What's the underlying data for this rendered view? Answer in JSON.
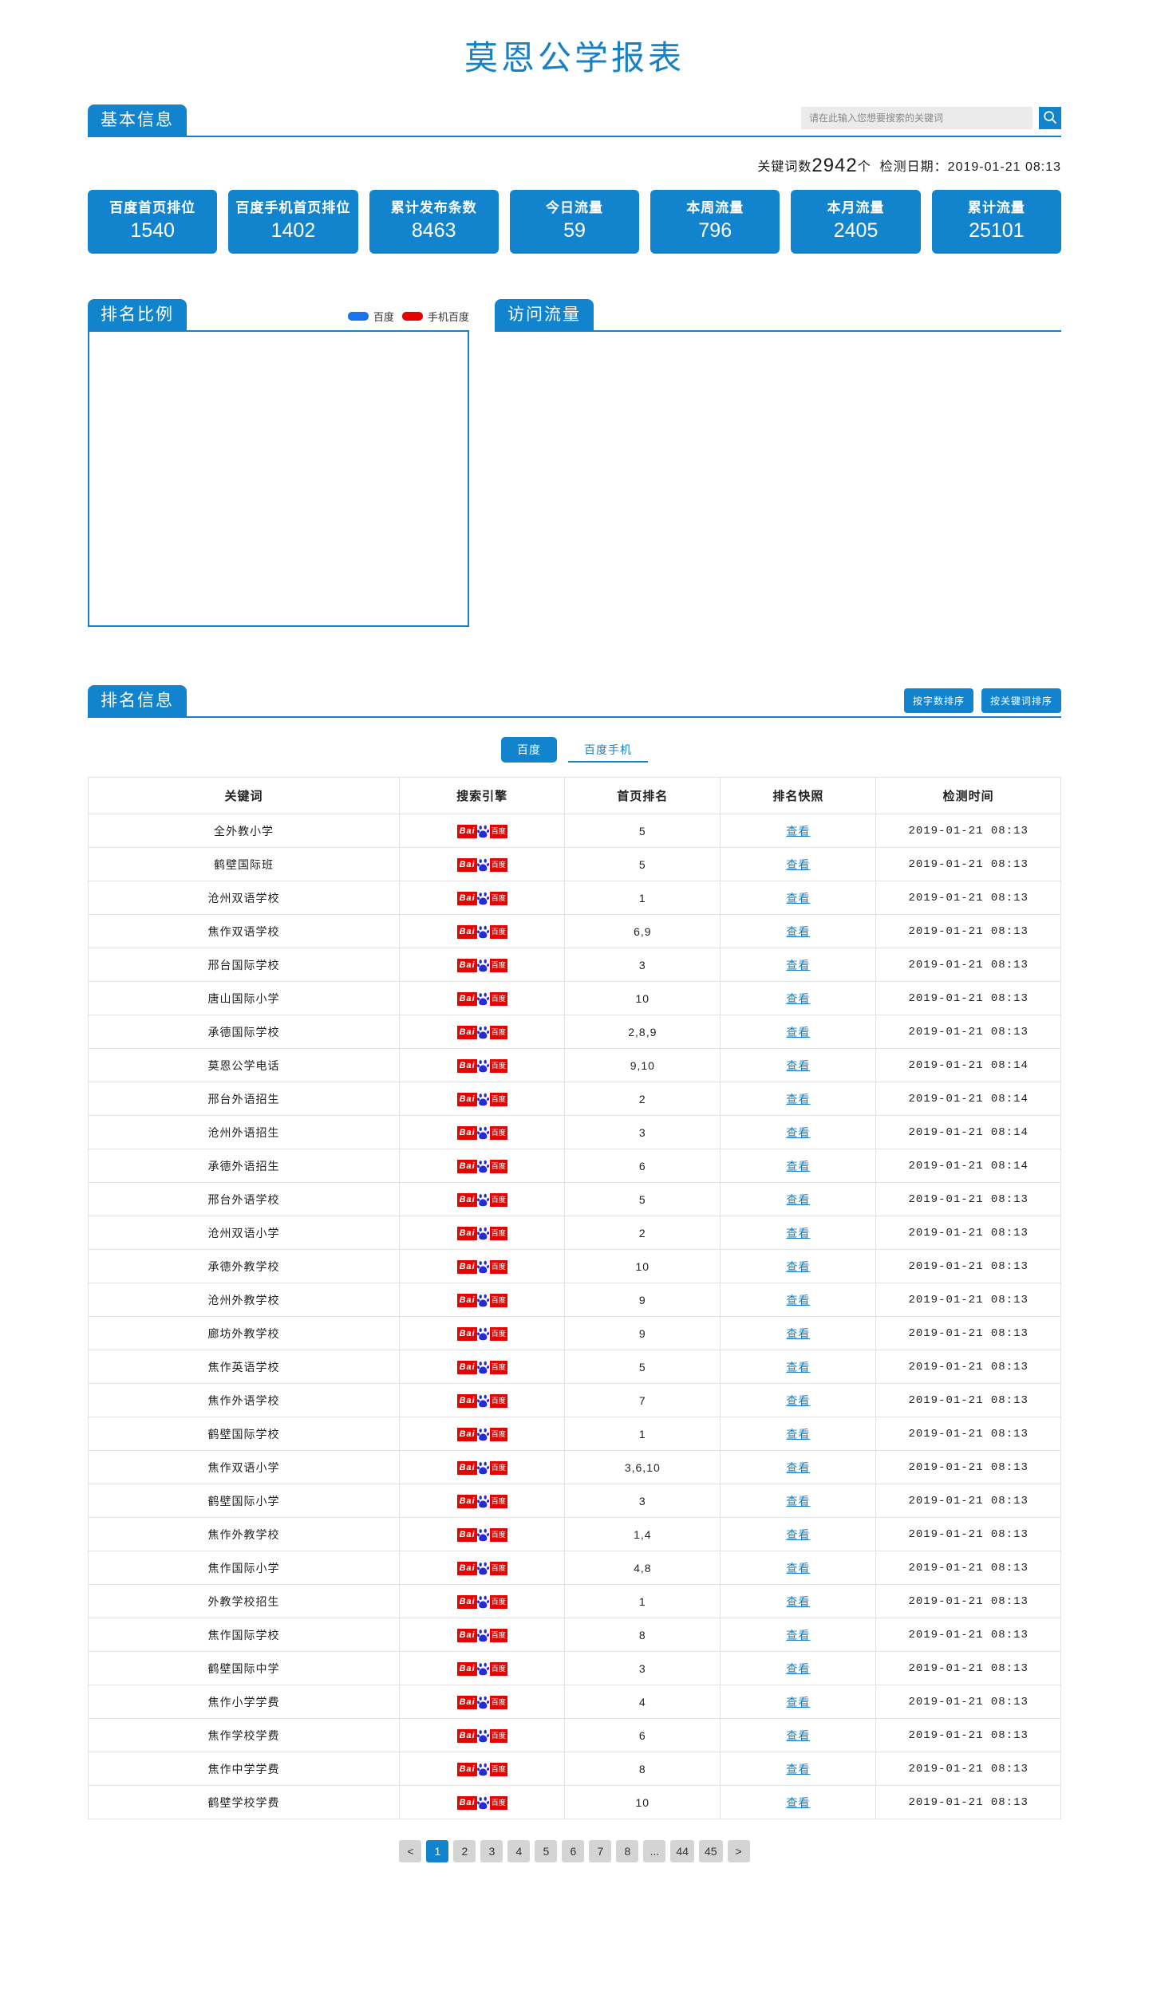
{
  "page_title": "莫恩公学报表",
  "colors": {
    "brand_blue": "#1284cd",
    "border_blue": "#1880c4",
    "baidu_red": "#e10602",
    "legend_baidu": "#1a73e8",
    "legend_mobile": "#e10602"
  },
  "basic_info": {
    "tab_label": "基本信息",
    "search_placeholder": "请在此输入您想要搜索的关键词",
    "search_value": "",
    "search_icon": "search-icon",
    "meta_prefix": "关键词数",
    "meta_count": "2942",
    "meta_unit": "个",
    "meta_date_label": "检测日期：",
    "meta_date_value": "2019-01-21 08:13"
  },
  "stats": [
    {
      "label": "百度首页排位",
      "value": "1540"
    },
    {
      "label": "百度手机首页排位",
      "value": "1402"
    },
    {
      "label": "累计发布条数",
      "value": "8463"
    },
    {
      "label": "今日流量",
      "value": "59"
    },
    {
      "label": "本周流量",
      "value": "796"
    },
    {
      "label": "本月流量",
      "value": "2405"
    },
    {
      "label": "累计流量",
      "value": "25101"
    }
  ],
  "rank_ratio": {
    "tab_label": "排名比例",
    "legend": [
      {
        "name": "百度",
        "color": "#1a73e8"
      },
      {
        "name": "手机百度",
        "color": "#e10602"
      }
    ]
  },
  "visit_traffic": {
    "tab_label": "访问流量"
  },
  "chart_data": [
    {
      "type": "pie",
      "title": "排名比例",
      "legend": [
        "百度",
        "手机百度"
      ],
      "legend_position": "top-right",
      "categories": [],
      "values": [],
      "note": "chart area rendered empty in screenshot"
    },
    {
      "type": "line",
      "title": "访问流量",
      "x": [],
      "series": [],
      "note": "chart area rendered empty in screenshot"
    }
  ],
  "rank_info": {
    "tab_label": "排名信息",
    "sort_buttons": [
      {
        "label": "按字数排序"
      },
      {
        "label": "按关键词排序"
      }
    ],
    "engine_tabs": [
      {
        "label": "百度",
        "active": true
      },
      {
        "label": "百度手机",
        "active": false
      }
    ],
    "columns": [
      "关键词",
      "搜索引擎",
      "首页排名",
      "排名快照",
      "检测时间"
    ],
    "snapshot_label": "查看",
    "engine_logo": "baidu-logo",
    "rows": [
      {
        "keyword": "全外教小学",
        "rank": "5",
        "time": "2019-01-21 08:13"
      },
      {
        "keyword": "鹤壁国际班",
        "rank": "5",
        "time": "2019-01-21 08:13"
      },
      {
        "keyword": "沧州双语学校",
        "rank": "1",
        "time": "2019-01-21 08:13"
      },
      {
        "keyword": "焦作双语学校",
        "rank": "6,9",
        "time": "2019-01-21 08:13"
      },
      {
        "keyword": "邢台国际学校",
        "rank": "3",
        "time": "2019-01-21 08:13"
      },
      {
        "keyword": "唐山国际小学",
        "rank": "10",
        "time": "2019-01-21 08:13"
      },
      {
        "keyword": "承德国际学校",
        "rank": "2,8,9",
        "time": "2019-01-21 08:13"
      },
      {
        "keyword": "莫恩公学电话",
        "rank": "9,10",
        "time": "2019-01-21 08:14"
      },
      {
        "keyword": "邢台外语招生",
        "rank": "2",
        "time": "2019-01-21 08:14"
      },
      {
        "keyword": "沧州外语招生",
        "rank": "3",
        "time": "2019-01-21 08:14"
      },
      {
        "keyword": "承德外语招生",
        "rank": "6",
        "time": "2019-01-21 08:14"
      },
      {
        "keyword": "邢台外语学校",
        "rank": "5",
        "time": "2019-01-21 08:13"
      },
      {
        "keyword": "沧州双语小学",
        "rank": "2",
        "time": "2019-01-21 08:13"
      },
      {
        "keyword": "承德外教学校",
        "rank": "10",
        "time": "2019-01-21 08:13"
      },
      {
        "keyword": "沧州外教学校",
        "rank": "9",
        "time": "2019-01-21 08:13"
      },
      {
        "keyword": "廊坊外教学校",
        "rank": "9",
        "time": "2019-01-21 08:13"
      },
      {
        "keyword": "焦作英语学校",
        "rank": "5",
        "time": "2019-01-21 08:13"
      },
      {
        "keyword": "焦作外语学校",
        "rank": "7",
        "time": "2019-01-21 08:13"
      },
      {
        "keyword": "鹤壁国际学校",
        "rank": "1",
        "time": "2019-01-21 08:13"
      },
      {
        "keyword": "焦作双语小学",
        "rank": "3,6,10",
        "time": "2019-01-21 08:13"
      },
      {
        "keyword": "鹤壁国际小学",
        "rank": "3",
        "time": "2019-01-21 08:13"
      },
      {
        "keyword": "焦作外教学校",
        "rank": "1,4",
        "time": "2019-01-21 08:13"
      },
      {
        "keyword": "焦作国际小学",
        "rank": "4,8",
        "time": "2019-01-21 08:13"
      },
      {
        "keyword": "外教学校招生",
        "rank": "1",
        "time": "2019-01-21 08:13"
      },
      {
        "keyword": "焦作国际学校",
        "rank": "8",
        "time": "2019-01-21 08:13"
      },
      {
        "keyword": "鹤壁国际中学",
        "rank": "3",
        "time": "2019-01-21 08:13"
      },
      {
        "keyword": "焦作小学学费",
        "rank": "4",
        "time": "2019-01-21 08:13"
      },
      {
        "keyword": "焦作学校学费",
        "rank": "6",
        "time": "2019-01-21 08:13"
      },
      {
        "keyword": "焦作中学学费",
        "rank": "8",
        "time": "2019-01-21 08:13"
      },
      {
        "keyword": "鹤壁学校学费",
        "rank": "10",
        "time": "2019-01-21 08:13"
      }
    ]
  },
  "pagination": {
    "prev": "<",
    "next": ">",
    "ellipsis": "...",
    "pages": [
      "1",
      "2",
      "3",
      "4",
      "5",
      "6",
      "7",
      "8"
    ],
    "tail_pages": [
      "44",
      "45"
    ],
    "current": "1"
  }
}
